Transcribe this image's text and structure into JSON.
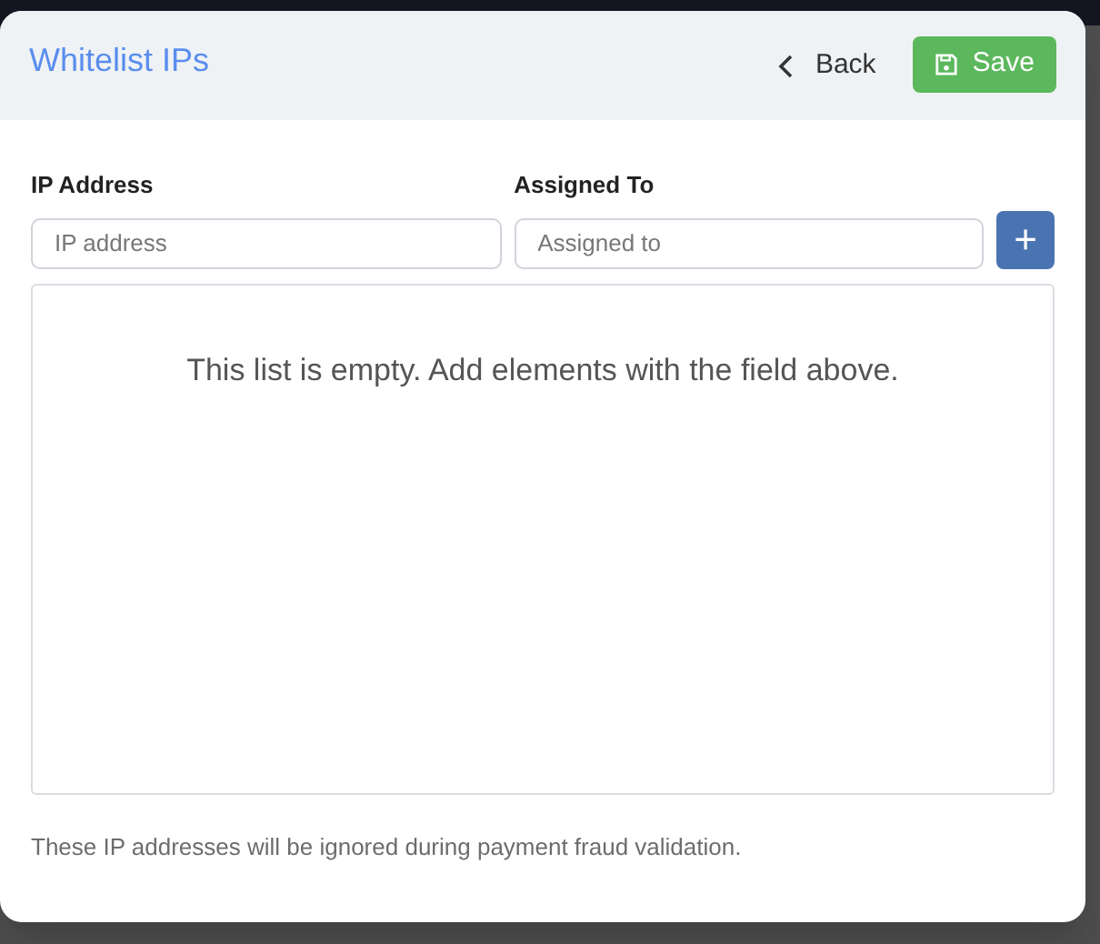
{
  "dialog": {
    "title": "Whitelist IPs",
    "back_button": "Back",
    "save_button": "Save",
    "fields": [
      {
        "label": "IP Address",
        "placeholder": "IP address"
      },
      {
        "label": "Assigned To",
        "placeholder": "Assigned to"
      }
    ],
    "add_button": "+",
    "empty_message": "This list is empty. Add elements with the field above.",
    "footnote": "These IP addresses will be ignored during payment fraud validation."
  }
}
